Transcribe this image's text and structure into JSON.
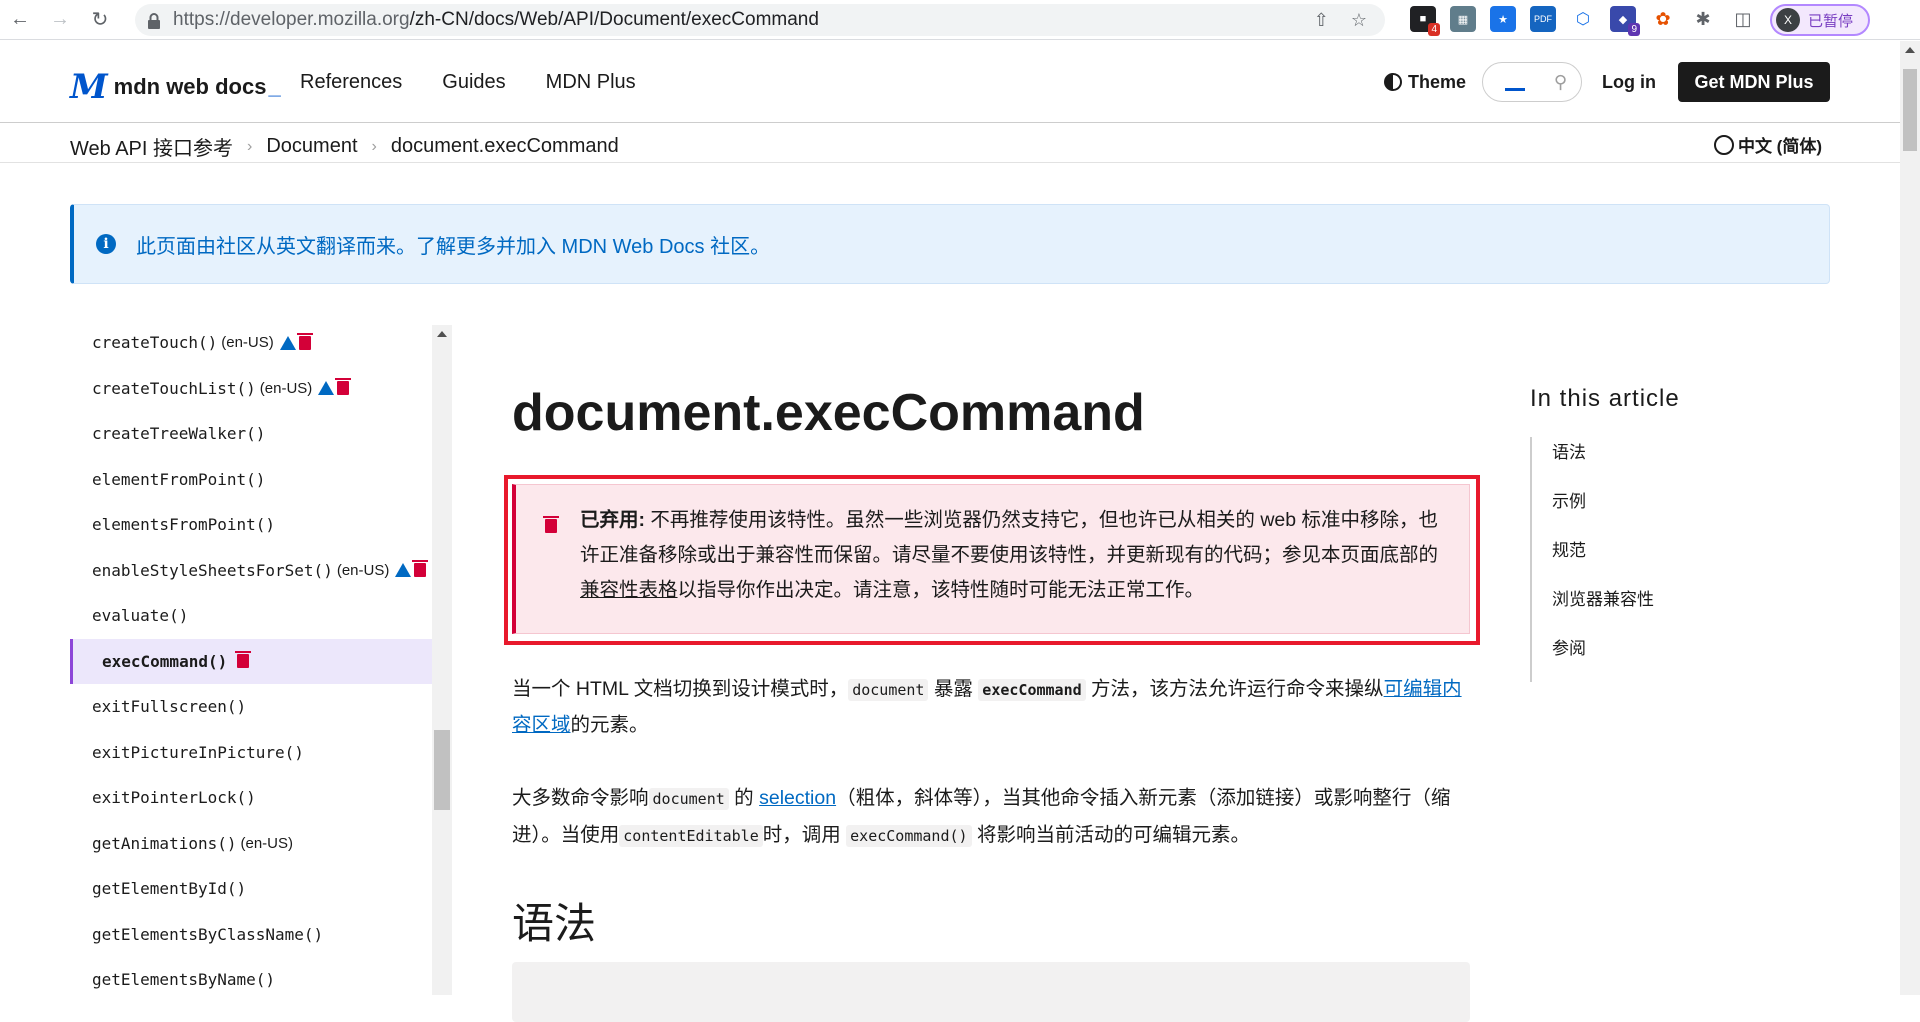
{
  "browser": {
    "url_host": "https://developer.mozilla.org",
    "url_path": "/zh-CN/docs/Web/API/Document/execCommand",
    "ext_badge_1": "4",
    "ext_badge_2": "9",
    "ext_pdf": "PDF",
    "profile_initial": "X",
    "profile_status": "已暂停"
  },
  "header": {
    "logo_text": "mdn web docs",
    "nav": [
      "References",
      "Guides",
      "MDN Plus"
    ],
    "theme_label": "Theme",
    "login_label": "Log in",
    "get_plus_label": "Get MDN Plus"
  },
  "breadcrumb": {
    "items": [
      "Web API 接口参考",
      "Document",
      "document.execCommand"
    ],
    "language": "中文 (简体)"
  },
  "notice": {
    "text": "此页面由社区从英文翻译而来。了解更多并加入 MDN Web Docs 社区。"
  },
  "sidebar": {
    "items": [
      {
        "label": "createTouch()",
        "note": "(en-US)"
      },
      {
        "label": "createTouchList()",
        "note": "(en-US)"
      },
      {
        "label": "createTreeWalker()",
        "note": ""
      },
      {
        "label": "elementFromPoint()",
        "note": ""
      },
      {
        "label": "elementsFromPoint()",
        "note": ""
      },
      {
        "label": "enableStyleSheetsForSet()",
        "note": "(en-US)"
      },
      {
        "label": "evaluate()",
        "note": ""
      },
      {
        "label": "execCommand()",
        "note": ""
      },
      {
        "label": "exitFullscreen()",
        "note": ""
      },
      {
        "label": "exitPictureInPicture()",
        "note": ""
      },
      {
        "label": "exitPointerLock()",
        "note": ""
      },
      {
        "label": "getAnimations()",
        "note": "(en-US)"
      },
      {
        "label": "getElementById()",
        "note": ""
      },
      {
        "label": "getElementsByClassName()",
        "note": ""
      },
      {
        "label": "getElementsByName()",
        "note": ""
      }
    ]
  },
  "article": {
    "title": "document.execCommand",
    "deprecated_label": "已弃用:",
    "deprecated_text_1": " 不再推荐使用该特性。虽然一些浏览器仍然支持它，但也许已从相关的 web 标准中移除，也许正准备移除或出于兼容性而保留。请尽量不要使用该特性，并更新现有的代码；参见本页面底部的",
    "deprecated_link": "兼容性表格",
    "deprecated_text_2": "以指导你作出决定。请注意，该特性随时可能无法正常工作。",
    "p1_a": "当一个 HTML 文档切换到设计模式时，",
    "p1_code1": "document",
    "p1_b": " 暴露 ",
    "p1_code2": "execCommand",
    "p1_c": " 方法，该方法允许运行命令来操纵",
    "p1_link": "可编辑内容区域",
    "p1_d": "的元素。",
    "p2_a": "大多数命令影响",
    "p2_code1": "document",
    "p2_b": " 的 ",
    "p2_link": "selection",
    "p2_c": "（粗体，斜体等），当其他命令插入新元素（添加链接）或影响整行（缩进）。当使用",
    "p2_code2": "contentEditable",
    "p2_d": "时，调用 ",
    "p2_code3": "execCommand()",
    "p2_e": " 将影响当前活动的可编辑元素。",
    "h2": "语法"
  },
  "toc": {
    "title": "In this article",
    "items": [
      "语法",
      "示例",
      "规范",
      "浏览器兼容性",
      "参阅"
    ]
  }
}
